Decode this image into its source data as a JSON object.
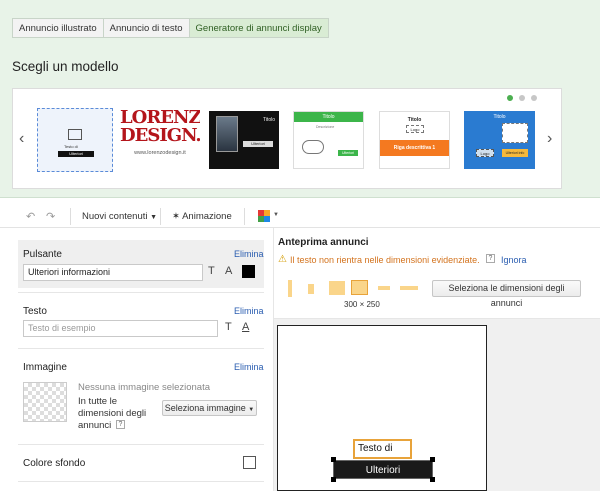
{
  "tabs": [
    {
      "label": "Annuncio illustrato"
    },
    {
      "label": "Annuncio di testo"
    },
    {
      "label": "Generatore di annunci display"
    }
  ],
  "heading": "Scegli un modello",
  "carousel": {
    "prev_icon": "chevron-left-icon",
    "next_icon": "chevron-right-icon",
    "thumb1": {
      "caption": "Testo di",
      "button": "Ulteriori"
    },
    "thumb2": {
      "line1": "LORENZO",
      "line2": "DESIGN.IT",
      "url": "www.lorenzodesign.it"
    },
    "thumb3": {
      "title": "Titolo",
      "button": "Ulteriori"
    },
    "thumb4": {
      "title": "Titolo",
      "subtitle": "Descrizione",
      "button": "Ulteriori"
    },
    "thumb5": {
      "title": "Titolo",
      "logo": "Logo",
      "band": "Riga descrittiva 1"
    },
    "thumb6": {
      "title": "Titolo",
      "logo": "Logo",
      "button": "Ulteriori info"
    }
  },
  "toolbar": {
    "nuovi_contenuti": "Nuovi contenuti",
    "animazione": "Animazione"
  },
  "pulsante": {
    "title": "Pulsante",
    "delete": "Elimina",
    "value": "Ulteriori informazioni",
    "color": "#000000"
  },
  "testo": {
    "title": "Testo",
    "delete": "Elimina",
    "placeholder": "Testo di esempio"
  },
  "immagine": {
    "title": "Immagine",
    "delete": "Elimina",
    "none_selected": "Nessuna immagine selezionata",
    "all_sizes_line1": "In tutte le",
    "all_sizes_line2": "dimensioni degli",
    "all_sizes_line3": "annunci",
    "help": "?",
    "select_button": "Seleziona immagine"
  },
  "colore_sfondo": {
    "title": "Colore sfondo"
  },
  "preview": {
    "title": "Anteprima annunci",
    "warning": "Il testo non rientra nelle dimensioni evidenziate.",
    "help": "?",
    "ignore": "Ignora",
    "select_sizes": "Seleziona le dimensioni degli annunci",
    "size_label": "300 × 250",
    "ad_text": "Testo di",
    "ad_button": "Ulteriori"
  },
  "colors": {
    "accent_green": "#4caf50",
    "link": "#2a5db0",
    "warning": "#d3731e",
    "size_tile": "#fad58a"
  }
}
